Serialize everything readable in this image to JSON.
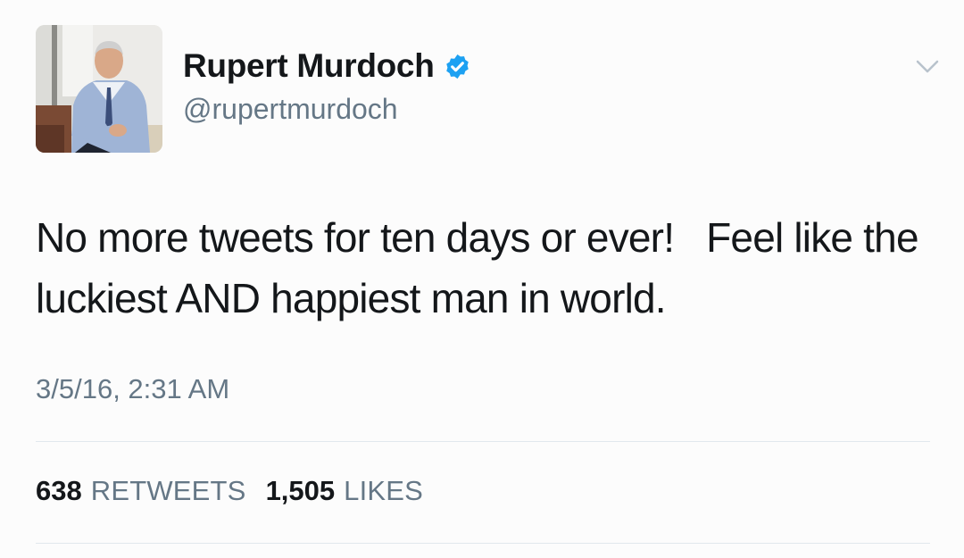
{
  "user": {
    "display_name": "Rupert Murdoch",
    "handle": "@rupertmurdoch",
    "verified": true,
    "verified_color": "#1da1f2"
  },
  "tweet": {
    "text": "No more tweets for ten days or ever!   Feel like the luckiest AND happiest man in world.",
    "timestamp": "3/5/16, 2:31 AM"
  },
  "stats": {
    "retweets_count": "638",
    "retweets_label": "RETWEETS",
    "likes_count": "1,505",
    "likes_label": "LIKES"
  },
  "icons": {
    "verified": "verified-badge-icon",
    "menu": "chevron-down-icon"
  }
}
